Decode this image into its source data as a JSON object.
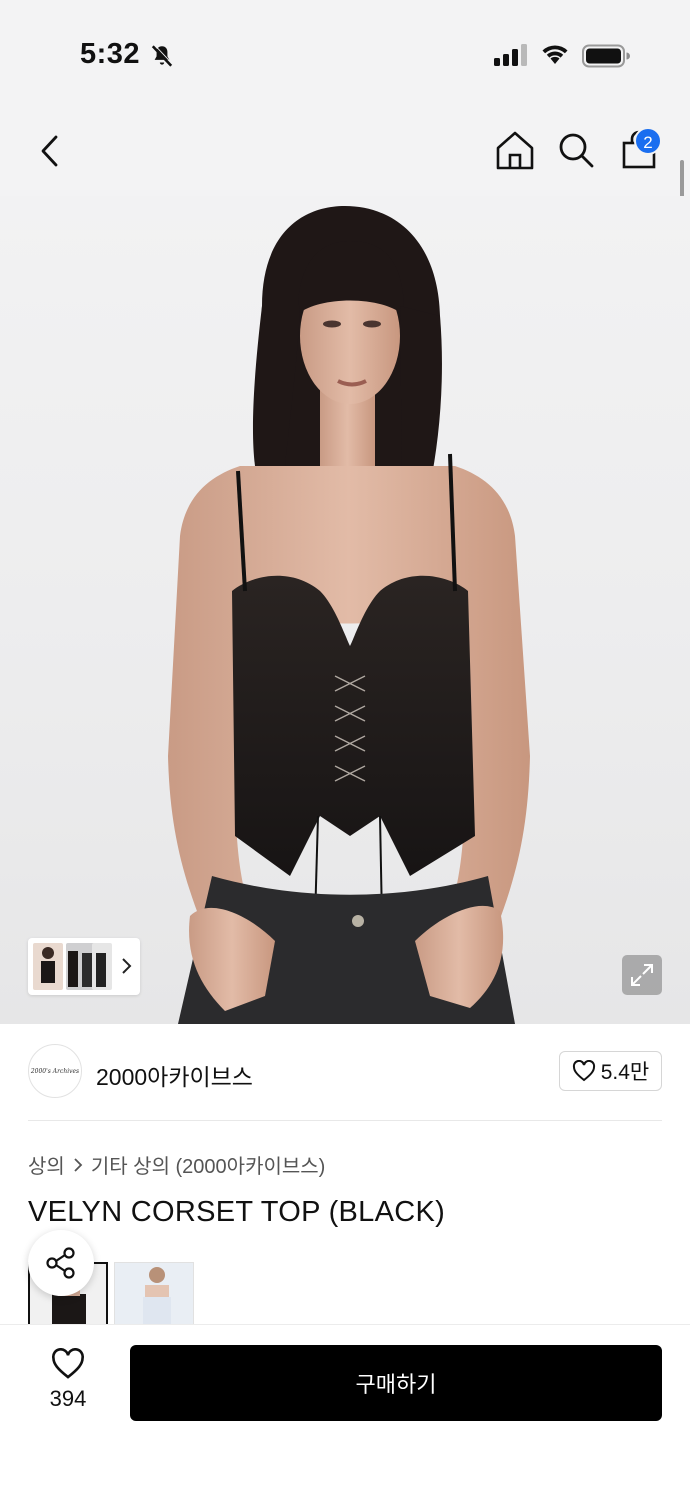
{
  "status_bar": {
    "time": "5:32",
    "icons": [
      "bell-slash-icon",
      "signal-icon",
      "wifi-icon",
      "battery-icon"
    ]
  },
  "header": {
    "icons": [
      "chevron-left-icon",
      "home-icon",
      "search-icon",
      "bag-icon"
    ],
    "cart_count": "2",
    "badge_color": "#1a6ef0"
  },
  "hero": {
    "thumbnail_count": 3
  },
  "brand": {
    "logo_text": "2000's Archives",
    "name": "2000아카이브스",
    "likes": "5.4만"
  },
  "breadcrumb": {
    "category": "상의",
    "subcategory": "기타 상의 (2000아카이브스)"
  },
  "product": {
    "title": "VELYN CORSET TOP (BLACK)"
  },
  "bottom_bar": {
    "wish_count": "394",
    "buy_label": "구매하기",
    "buy_color": "#000000"
  }
}
